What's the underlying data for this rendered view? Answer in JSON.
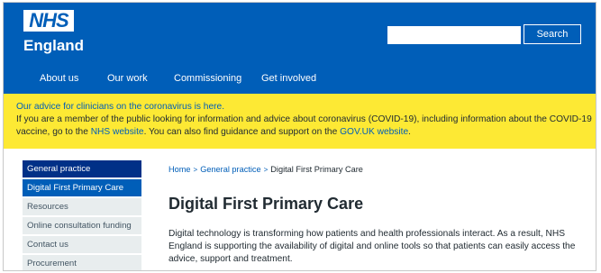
{
  "header": {
    "logo_text": "NHS",
    "org_name": "England",
    "search_placeholder": "",
    "search_button": "Search",
    "nav": [
      "About us",
      "Our work",
      "Commissioning",
      "Get involved"
    ]
  },
  "alert": {
    "line1": "Our advice for clinicians on the coronavirus is here.",
    "line2": "If you are a member of the public looking for information and advice about coronavirus (COVID-19), including information about the COVID-19",
    "line3_pre": "vaccine, go to the ",
    "line3_link1": "NHS website",
    "line3_mid": ". You can also find guidance and support on the ",
    "line3_link2": "GOV.UK website",
    "line3_post": "."
  },
  "sidebar": {
    "items": [
      {
        "label": "General practice"
      },
      {
        "label": "Digital First Primary Care"
      },
      {
        "label": "Resources"
      },
      {
        "label": "Online consultation funding"
      },
      {
        "label": "Contact us"
      },
      {
        "label": "Procurement"
      }
    ]
  },
  "breadcrumb": {
    "home": "Home",
    "section": "General practice",
    "current": "Digital First Primary Care",
    "separator": ">"
  },
  "main": {
    "title": "Digital First Primary Care",
    "intro": "Digital technology is transforming how patients and health professionals interact. As a result, NHS England is supporting the availability of digital and online tools so that patients can easily access the advice, support and treatment."
  },
  "colors": {
    "nhs_blue": "#005eb8",
    "dark_blue": "#003087",
    "alert_yellow": "#fde934",
    "sidebar_grey": "#e8edee"
  }
}
